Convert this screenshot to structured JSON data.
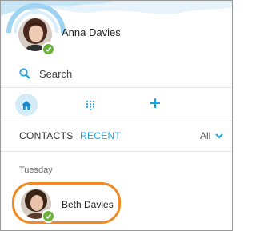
{
  "profile": {
    "name": "Anna Davies",
    "status": "online"
  },
  "search": {
    "label": "Search"
  },
  "nav": {
    "items": [
      {
        "icon": "home-icon",
        "active": true
      },
      {
        "icon": "dialpad-icon",
        "active": false
      },
      {
        "icon": "add-icon",
        "active": false
      }
    ]
  },
  "tabs": {
    "contacts": "CONTACTS",
    "recent": "RECENT",
    "active": "recent"
  },
  "filter": {
    "label": "All"
  },
  "recent": {
    "section_header": "Tuesday",
    "items": [
      {
        "name": "Beth Davies",
        "status": "online",
        "highlighted": true
      }
    ]
  },
  "colors": {
    "accent": "#1aa3e8",
    "presence_online": "#6cb33e",
    "highlight_ring": "#f08a24",
    "home_bg": "#d3ecf8"
  }
}
